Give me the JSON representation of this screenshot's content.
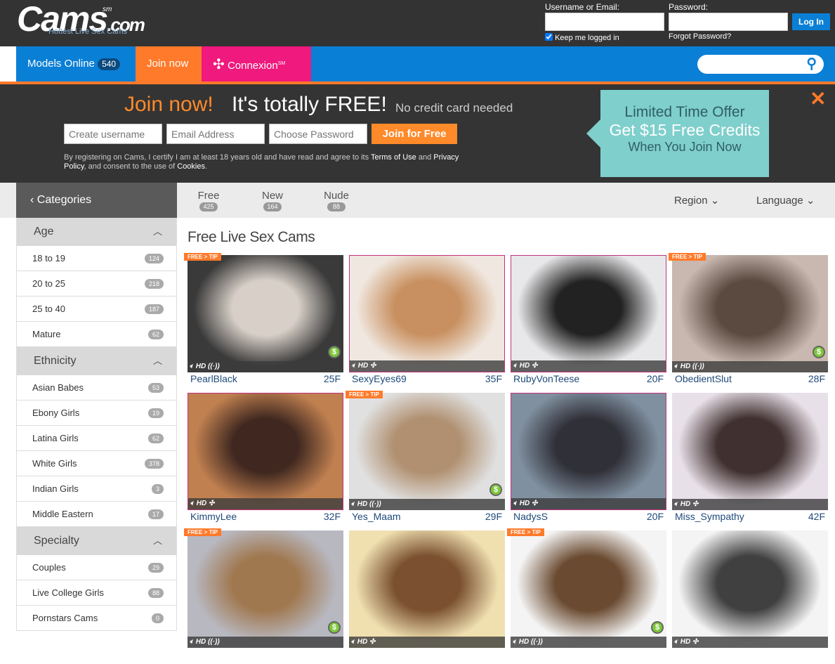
{
  "header": {
    "logo": "Cams",
    "logo_suffix": "sm",
    "logo_domain": ".com",
    "tagline": "Hottest Live Sex Cams",
    "username_label": "Username or Email:",
    "password_label": "Password:",
    "login_button": "Log In",
    "keep_logged": "Keep me logged in",
    "keep_logged_checked": true,
    "forgot": "Forgot Password?"
  },
  "nav": {
    "models_online": "Models Online",
    "models_count": "540",
    "join": "Join now",
    "connexion": "Connexion",
    "connexion_sup": "SM"
  },
  "promo": {
    "join": "Join now!",
    "free": "It's totally FREE!",
    "no_cc": "No credit card needed",
    "username_ph": "Create username",
    "email_ph": "Email Address",
    "password_ph": "Choose Password",
    "submit": "Join for Free",
    "legal_1": "By registering on Cams, I certify I am at least 18 years old and have read and agree to its ",
    "terms": "Terms of Use",
    "and": " and ",
    "privacy": "Privacy Policy",
    "legal_2": ", and consent to the use of ",
    "cookies": "Cookies",
    "legal_3": ".",
    "offer_1": "Limited Time Offer",
    "offer_2": "Get $15 Free Credits",
    "offer_3": "When You Join Now"
  },
  "filters": {
    "categories": "Categories",
    "tabs": [
      {
        "label": "Free",
        "count": "425"
      },
      {
        "label": "New",
        "count": "164"
      },
      {
        "label": "Nude",
        "count": "88"
      }
    ],
    "region": "Region",
    "language": "Language"
  },
  "sidebar": [
    {
      "title": "Age",
      "items": [
        {
          "label": "18 to 19",
          "count": "124"
        },
        {
          "label": "20 to 25",
          "count": "218"
        },
        {
          "label": "25 to 40",
          "count": "187"
        },
        {
          "label": "Mature",
          "count": "62"
        }
      ]
    },
    {
      "title": "Ethnicity",
      "items": [
        {
          "label": "Asian Babes",
          "count": "53"
        },
        {
          "label": "Ebony Girls",
          "count": "19"
        },
        {
          "label": "Latina Girls",
          "count": "62"
        },
        {
          "label": "White Girls",
          "count": "378"
        },
        {
          "label": "Indian Girls",
          "count": "3"
        },
        {
          "label": "Middle Eastern",
          "count": "17"
        }
      ]
    },
    {
      "title": "Specialty",
      "items": [
        {
          "label": "Couples",
          "count": "29"
        },
        {
          "label": "Live College Girls",
          "count": "88"
        },
        {
          "label": "Pornstars Cams",
          "count": "0"
        }
      ]
    }
  ],
  "main": {
    "title": "Free Live Sex Cams",
    "tip_label": "FREE > TIP",
    "hd_label": "HD",
    "models": [
      {
        "name": "PearlBlack",
        "age": "25F",
        "tip": true,
        "dollar": true,
        "pink": false,
        "c1": "#3a3a3a",
        "c2": "#d8d0c8"
      },
      {
        "name": "SexyEyes69",
        "age": "35F",
        "tip": false,
        "dollar": false,
        "pink": true,
        "c1": "#f0e8e0",
        "c2": "#c89060"
      },
      {
        "name": "RubyVonTeese",
        "age": "20F",
        "tip": false,
        "dollar": false,
        "pink": true,
        "c1": "#e8e8ea",
        "c2": "#222"
      },
      {
        "name": "ObedientSlut",
        "age": "28F",
        "tip": true,
        "dollar": true,
        "pink": false,
        "c1": "#c8b8b0",
        "c2": "#5a4a40"
      },
      {
        "name": "KimmyLee",
        "age": "32F",
        "tip": false,
        "dollar": false,
        "pink": true,
        "c1": "#c08050",
        "c2": "#402820"
      },
      {
        "name": "Yes_Maam",
        "age": "29F",
        "tip": true,
        "dollar": true,
        "pink": false,
        "c1": "#e0e0e0",
        "c2": "#b09070"
      },
      {
        "name": "NadysS",
        "age": "20F",
        "tip": false,
        "dollar": false,
        "pink": true,
        "c1": "#8090a0",
        "c2": "#303038"
      },
      {
        "name": "Miss_Sympathy",
        "age": "42F",
        "tip": false,
        "dollar": false,
        "pink": false,
        "c1": "#e8e0e8",
        "c2": "#403030"
      },
      {
        "name": "",
        "age": "",
        "tip": true,
        "dollar": true,
        "pink": false,
        "c1": "#b8b8c0",
        "c2": "#a07850"
      },
      {
        "name": "",
        "age": "",
        "tip": false,
        "dollar": false,
        "pink": false,
        "c1": "#f0e0b0",
        "c2": "#7a5030"
      },
      {
        "name": "",
        "age": "",
        "tip": true,
        "dollar": true,
        "pink": false,
        "c1": "#f4f4f4",
        "c2": "#6a4a30"
      },
      {
        "name": "",
        "age": "",
        "tip": false,
        "dollar": false,
        "pink": false,
        "c1": "#f4f4f4",
        "c2": "#404040"
      }
    ]
  }
}
